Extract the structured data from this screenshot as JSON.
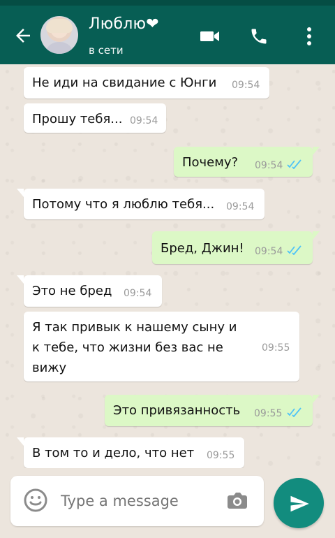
{
  "header": {
    "title": "Люблю❤",
    "status": "в сети",
    "icons": [
      "arrow-back-icon",
      "video-call-icon",
      "phone-icon",
      "more-vertical-icon"
    ]
  },
  "messages": [
    {
      "text": "Не иди на свидание с Юнги",
      "time": "09:54",
      "direction": "incoming"
    },
    {
      "text": "Прошу тебя...",
      "time": "09:54",
      "direction": "incoming"
    },
    {
      "text": "Почему?",
      "time": "09:54",
      "direction": "outgoing",
      "status": "read"
    },
    {
      "text": "Потому что я люблю тебя...",
      "time": "09:54",
      "direction": "incoming"
    },
    {
      "text": "Бред, Джин!",
      "time": "09:54",
      "direction": "outgoing",
      "status": "read"
    },
    {
      "text": "Это не бред",
      "time": "09:54",
      "direction": "incoming"
    },
    {
      "text": "Я так привык к нашему сыну и\nк тебе, что жизни без вас не\nвижу",
      "time": "09:55",
      "direction": "incoming"
    },
    {
      "text": "Это привязанность",
      "time": "09:55",
      "direction": "outgoing",
      "status": "read"
    },
    {
      "text": "В том то и дело, что нет",
      "time": "09:55",
      "direction": "incoming"
    }
  ],
  "composer": {
    "placeholder": "Type a message",
    "icons": [
      "emoji-icon",
      "camera-icon",
      "send-icon"
    ]
  },
  "colors": {
    "header": "#075e54",
    "statusbar": "#054d44",
    "incoming_bubble": "#ffffff",
    "outgoing_bubble": "#dcf8c6",
    "read_ticks": "#4fc3f7",
    "send_button": "#128c7e"
  }
}
